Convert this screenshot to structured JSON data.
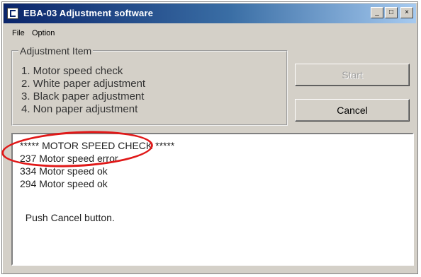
{
  "window": {
    "title": "EBA-03 Adjustment software",
    "controls": {
      "minimize": "_",
      "maximize": "□",
      "close": "×"
    }
  },
  "menu": {
    "file": "File",
    "option": "Option"
  },
  "adjustment_group": {
    "legend": "Adjustment Item",
    "items": [
      "1. Motor speed check",
      "2. White paper adjustment",
      "3. Black paper adjustment",
      "4. Non paper adjustment"
    ]
  },
  "buttons": {
    "start": "Start",
    "cancel": "Cancel",
    "start_enabled": false
  },
  "log": {
    "lines": [
      "***** MOTOR SPEED CHECK *****",
      "237 Motor speed error",
      "334 Motor speed ok",
      "294 Motor speed ok",
      "",
      "  Push Cancel button."
    ]
  },
  "annotation": {
    "color": "#e01818"
  }
}
